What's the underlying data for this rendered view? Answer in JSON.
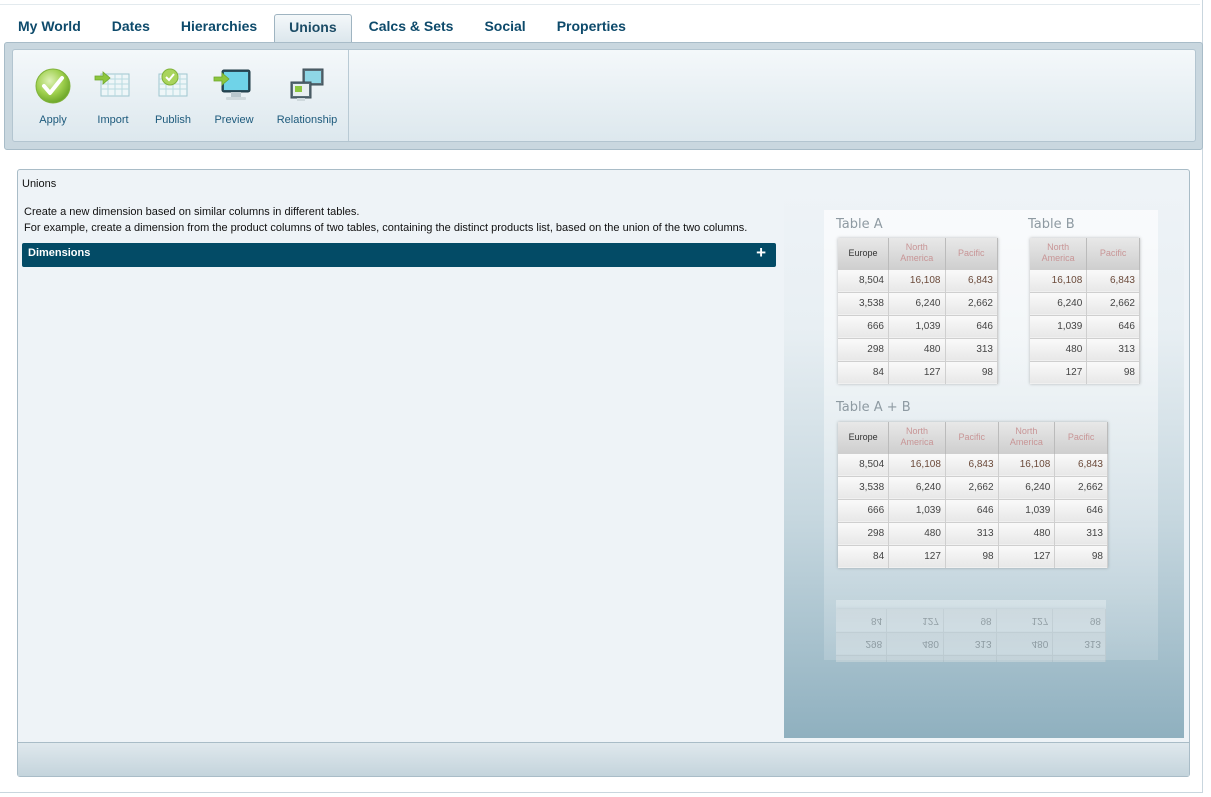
{
  "tabs": [
    {
      "label": "My World",
      "active": false
    },
    {
      "label": "Dates",
      "active": false
    },
    {
      "label": "Hierarchies",
      "active": false
    },
    {
      "label": "Unions",
      "active": true
    },
    {
      "label": "Calcs & Sets",
      "active": false
    },
    {
      "label": "Social",
      "active": false
    },
    {
      "label": "Properties",
      "active": false
    }
  ],
  "toolbar": {
    "apply": {
      "label": "Apply",
      "icon": "checkmark-icon"
    },
    "import": {
      "label": "Import",
      "icon": "table-import-icon"
    },
    "publish": {
      "label": "Publish",
      "icon": "table-publish-icon"
    },
    "preview": {
      "label": "Preview",
      "icon": "monitor-preview-icon"
    },
    "relationship": {
      "label": "Relationship",
      "icon": "relationship-icon"
    }
  },
  "panel": {
    "title": "Unions",
    "description_line1": "Create a new dimension based on similar columns in different tables.",
    "description_line2": "For example, create a dimension from the product columns of two tables, containing the distinct products list, based on the union of the two columns.",
    "dimensions_label": "Dimensions",
    "add_symbol": "+"
  },
  "illustration": {
    "table_a": {
      "title": "Table A",
      "headers": [
        "Europe",
        "North America",
        "Pacific"
      ],
      "rows": [
        [
          "8,504",
          "16,108",
          "6,843"
        ],
        [
          "3,538",
          "6,240",
          "2,662"
        ],
        [
          "666",
          "1,039",
          "646"
        ],
        [
          "298",
          "480",
          "313"
        ],
        [
          "84",
          "127",
          "98"
        ]
      ]
    },
    "table_b": {
      "title": "Table B",
      "headers": [
        "North America",
        "Pacific"
      ],
      "rows": [
        [
          "16,108",
          "6,843"
        ],
        [
          "6,240",
          "2,662"
        ],
        [
          "1,039",
          "646"
        ],
        [
          "480",
          "313"
        ],
        [
          "127",
          "98"
        ]
      ]
    },
    "table_ab": {
      "title": "Table A + B",
      "headers": [
        "Europe",
        "North America",
        "Pacific",
        "North America",
        "Pacific"
      ],
      "rows": [
        [
          "8,504",
          "16,108",
          "6,843",
          "16,108",
          "6,843"
        ],
        [
          "3,538",
          "6,240",
          "2,662",
          "6,240",
          "2,662"
        ],
        [
          "666",
          "1,039",
          "646",
          "1,039",
          "646"
        ],
        [
          "298",
          "480",
          "313",
          "480",
          "313"
        ],
        [
          "84",
          "127",
          "98",
          "127",
          "98"
        ]
      ]
    }
  },
  "colors": {
    "tab_text": "#0d4a6b",
    "dimensions_bar": "#034b66",
    "apply_green": "#8cc63f"
  }
}
